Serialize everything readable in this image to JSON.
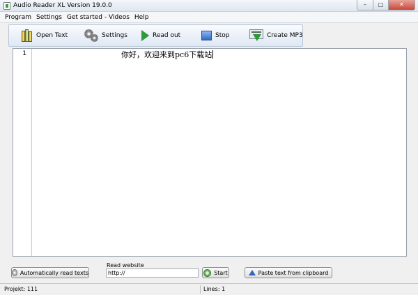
{
  "window": {
    "title": "Audio Reader XL Version 19.0.0"
  },
  "menu": {
    "items": [
      "Program",
      "Settings",
      "Get started - Videos",
      "Help"
    ]
  },
  "toolbar": {
    "open_text": "Open Text",
    "settings": "Settings",
    "read_out": "Read out",
    "stop": "Stop",
    "create_mp3": "Create MP3"
  },
  "editor": {
    "line_number": "1",
    "text": "你好，欢迎来到pc6下载站"
  },
  "bottom": {
    "auto_read_label": "Automatically read texts",
    "read_website_label": "Read website",
    "url_value": "http://",
    "start_label": "Start",
    "paste_label": "Paste text from clipboard"
  },
  "status": {
    "project": "Projekt: 111",
    "lines": "Lines: 1"
  },
  "colors": {
    "toolbar_border": "#b7c5d6",
    "play_green": "#2f9a3a",
    "stop_blue": "#2f6bc4",
    "close_red": "#c7473a"
  },
  "icons": {
    "open_text": "books-icon",
    "settings": "gears-icon",
    "read_out": "play-icon",
    "stop": "stop-icon",
    "create_mp3": "mp3-download-icon"
  }
}
